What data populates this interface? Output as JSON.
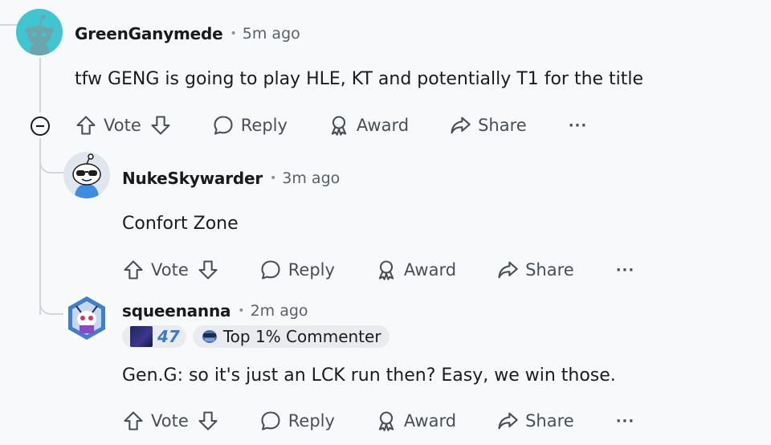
{
  "comments": [
    {
      "username": "GreenGanymede",
      "separator": "•",
      "time": "5m ago",
      "body": "tfw GENG is going to play HLE, KT and potentially T1 for the title",
      "actions": {
        "vote": "Vote",
        "reply": "Reply",
        "award": "Award",
        "share": "Share",
        "more": "···"
      }
    },
    {
      "username": "NukeSkywarder",
      "separator": "•",
      "time": "3m ago",
      "body": "Confort Zone",
      "actions": {
        "vote": "Vote",
        "reply": "Reply",
        "award": "Award",
        "share": "Share",
        "more": "···"
      }
    },
    {
      "username": "squeenanna",
      "separator": "•",
      "time": "2m ago",
      "flair_number": "47",
      "badge": "Top 1% Commenter",
      "body": "Gen.G: so it's just an LCK run then? Easy, we win those.",
      "actions": {
        "vote": "Vote",
        "reply": "Reply",
        "award": "Award",
        "share": "Share",
        "more": "···"
      }
    }
  ],
  "colors": {
    "background": "#f8f9fb",
    "action_text": "#4a4f55",
    "thread_line": "#d3d6da",
    "avatar_teal": "#3fc6d0",
    "flair_blue": "#3d78c9"
  },
  "icons": [
    "collapse-icon",
    "upvote-icon",
    "downvote-icon",
    "reply-icon",
    "award-icon",
    "share-icon",
    "more-icon"
  ]
}
